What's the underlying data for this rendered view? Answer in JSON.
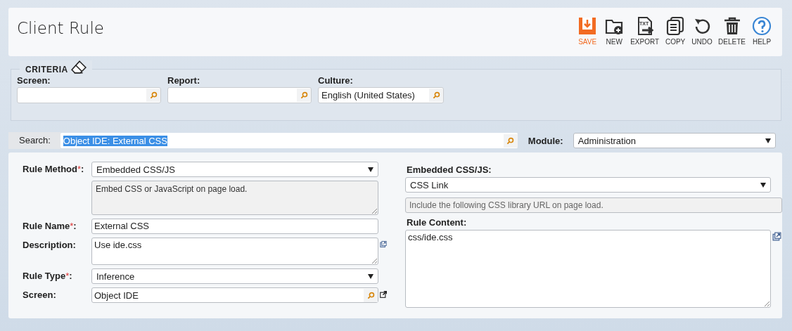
{
  "page": {
    "title": "Client Rule"
  },
  "toolbar": [
    {
      "kind": "save",
      "label": "SAVE",
      "highlighted": true
    },
    {
      "kind": "new",
      "label": "NEW",
      "highlighted": false
    },
    {
      "kind": "export",
      "label": "EXPORT",
      "highlighted": false,
      "icon_text": "TXT"
    },
    {
      "kind": "copy",
      "label": "COPY",
      "highlighted": false
    },
    {
      "kind": "undo",
      "label": "UNDO",
      "highlighted": false
    },
    {
      "kind": "delete",
      "label": "DELETE",
      "highlighted": false
    },
    {
      "kind": "help",
      "label": "HELP",
      "highlighted": false
    }
  ],
  "criteria": {
    "title": "CRITERIA",
    "fields": [
      {
        "label": "Screen:"
      },
      {
        "label": "Report:"
      },
      {
        "label": "Culture:",
        "value": "English (United States)"
      }
    ]
  },
  "search": {
    "label": "Search:",
    "value": "Object IDE: External CSS",
    "text_selected": true
  },
  "module": {
    "label": "Module:",
    "value": "Administration"
  },
  "required_mark": "*",
  "label_colon": ":",
  "left_fields": [
    {
      "kind": "select",
      "label": "Rule Method",
      "required": true,
      "value": "Embedded CSS/JS",
      "note": "Embed CSS or JavaScript on page load."
    },
    {
      "kind": "text",
      "label": "Rule Name",
      "required": true,
      "value": "External CSS"
    },
    {
      "kind": "textarea",
      "label": "Description",
      "required": false,
      "value": "Use ide.css"
    },
    {
      "kind": "select",
      "label": "Rule Type",
      "required": true,
      "value": "Inference"
    },
    {
      "kind": "lookup",
      "label": "Screen",
      "required": false,
      "value": "Object IDE"
    }
  ],
  "right_fields": [
    {
      "kind": "select",
      "label": "Embedded CSS/JS:",
      "value": "CSS Link",
      "note": "Include the following CSS library URL on page load."
    },
    {
      "kind": "textarea",
      "label": "Rule Content:",
      "value": "css/ide.css"
    }
  ]
}
